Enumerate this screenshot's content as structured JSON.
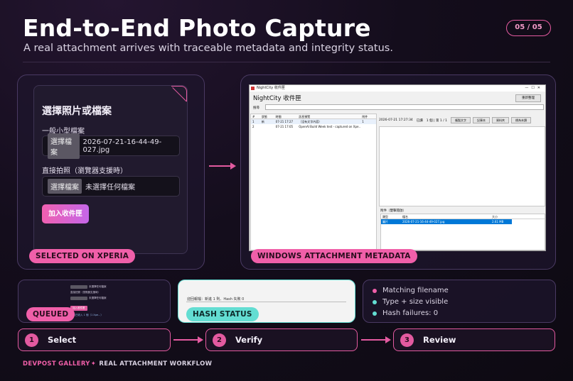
{
  "header": {
    "title": "End-to-End Photo Capture",
    "subtitle": "A real attachment arrives with traceable metadata and integrity status.",
    "pager": "05 / 05"
  },
  "left_panel": {
    "tag": "SELECTED ON XPERIA",
    "card_title": "選擇照片或檔案",
    "small_file_label": "一般小型檔案",
    "small_file_button": "選擇檔案",
    "small_file_value": "2026-07-21-16-44-49-027.jpg",
    "camera_label": "直接拍照（瀏覽器支援時）",
    "camera_button": "選擇檔案",
    "camera_value": "未選擇任何檔案",
    "add_button": "加入收件匣"
  },
  "right_panel": {
    "tag": "WINDOWS ATTACHMENT METADATA",
    "window": {
      "titlebar": "NightCity 收件匣",
      "app_title": "NightCity 收件匣",
      "top_button": "重新整理",
      "search_label": "搜尋",
      "list_headers": [
        "#",
        "狀態",
        "時間",
        "訊息預覽",
        "附件"
      ],
      "list_rows": [
        [
          "1",
          "新",
          "07-21 17:27",
          "（沒有文字內容）",
          "1"
        ],
        [
          "2",
          "",
          "07-21 17:05",
          "OpenAI Build Week test - captured on Xpe...",
          ""
        ]
      ],
      "detail_time": "2026-07-21 17:27:34",
      "detail_status": "已讀",
      "detail_count": "1 個 | 第 1 / 1",
      "detail_buttons": [
        "複製文字",
        "記事本",
        "資料夾",
        "標為未讀"
      ],
      "attachment_label": "附件（雙擊開啟）",
      "attachment_headers": [
        "類型",
        "檔名",
        "大小"
      ],
      "attachment_row": [
        "圖片",
        "2026-07-21-16-44-49-027.jpg",
        "2.61 MB"
      ]
    }
  },
  "queued": {
    "tag": "QUEUED",
    "mini_lines": [
      "未選擇任何檔案",
      "直接拍照（瀏覽器支援時）",
      "未選擇任何檔案",
      "加入收件匣",
      "目前已收入 1 個（1 Xpe...）"
    ]
  },
  "hash": {
    "tag": "HASH STATUS",
    "text": "迎回報檔：新進 1 則、Hash 失敗 0"
  },
  "checks": [
    {
      "text": "Matching filename",
      "color": "#f05fa9"
    },
    {
      "text": "Type + size visible",
      "color": "#63ddd2"
    },
    {
      "text": "Hash failures: 0",
      "color": "#63ddd2"
    }
  ],
  "steps": [
    {
      "num": "1",
      "label": "Select"
    },
    {
      "num": "2",
      "label": "Verify"
    },
    {
      "num": "3",
      "label": "Review"
    }
  ],
  "footer": {
    "brand": "DEVPOST GALLERY",
    "rest": "REAL ATTACHMENT WORKFLOW"
  }
}
